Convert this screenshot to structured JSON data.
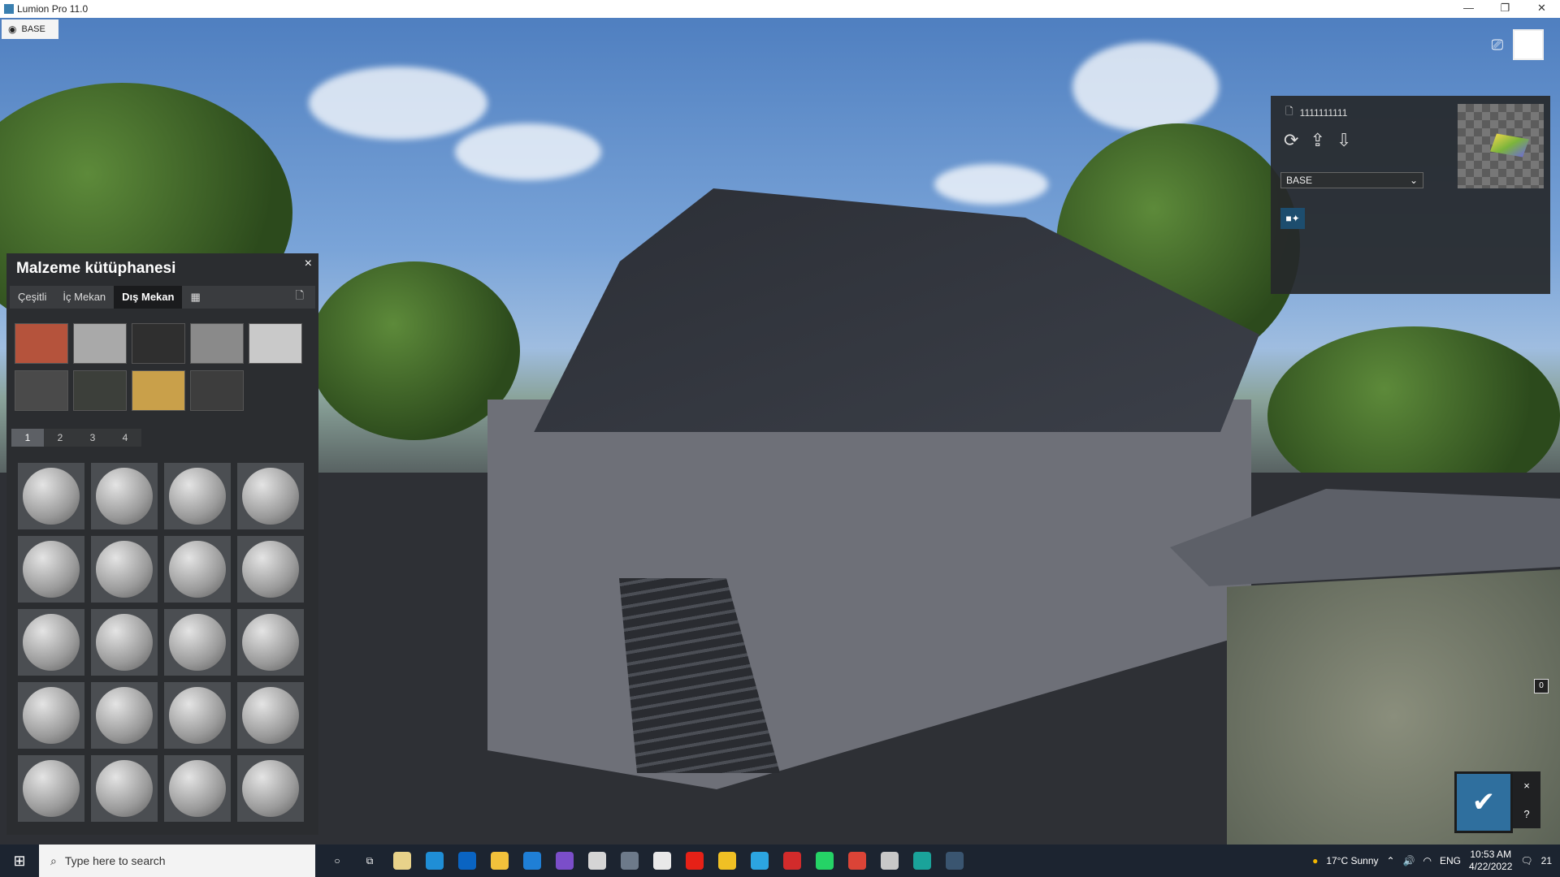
{
  "window": {
    "title": "Lumion Pro 11.0",
    "controls": [
      "—",
      "❐",
      "✕"
    ]
  },
  "view_chip": {
    "label": "BASE"
  },
  "material_editor": {
    "name": "1111111111",
    "layer_select": "BASE",
    "toggle_label": "■✦"
  },
  "library": {
    "title": "Malzeme kütüphanesi",
    "tabs": [
      "Çeşitli",
      "İç Mekan",
      "Dış Mekan"
    ],
    "active_tab": "Dış Mekan",
    "swatch_colors": [
      "#b5533c",
      "#a9a9a9",
      "#2f2f2f",
      "#8a8a8a",
      "#c9c9c9",
      "#4a4a4a",
      "#3c3f3a",
      "#c9a04a",
      "#3d3d3d"
    ],
    "pages": [
      "1",
      "2",
      "3",
      "4"
    ],
    "active_page": "1"
  },
  "confirm": {
    "check": "✔",
    "close": "×",
    "help": "?"
  },
  "zero_badge": "0",
  "taskbar": {
    "search_placeholder": "Type here to search",
    "weather": "17°C  Sunny",
    "language": "ENG",
    "time": "10:53 AM",
    "date": "4/22/2022",
    "notifications": "21"
  }
}
